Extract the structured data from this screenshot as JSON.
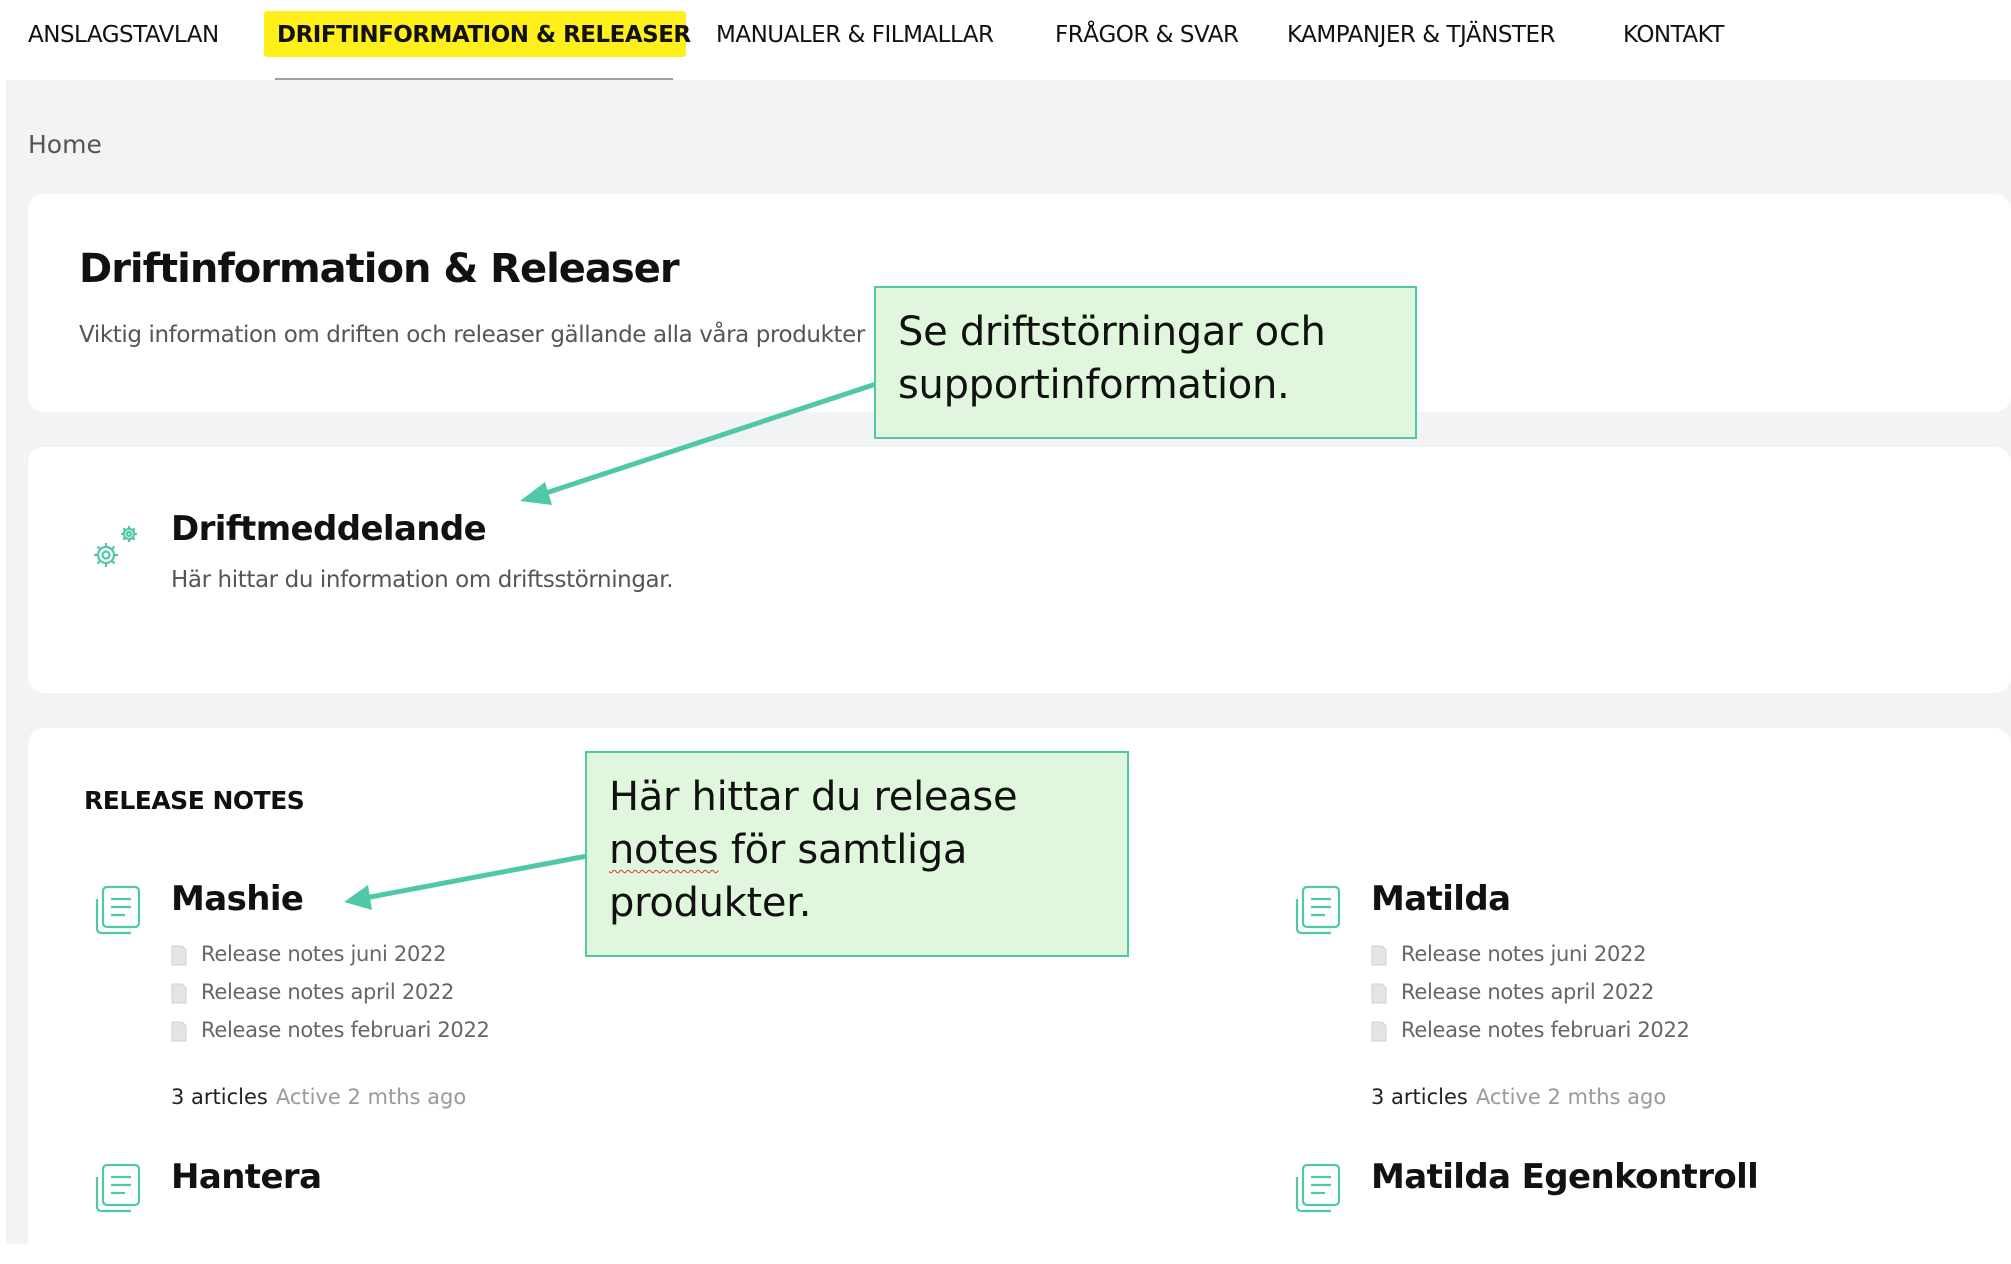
{
  "nav": {
    "items": [
      {
        "label": "ANSLAGSTAVLAN"
      },
      {
        "label": "DRIFTINFORMATION & RELEASER"
      },
      {
        "label": "MANUALER & FILMALLAR"
      },
      {
        "label": "FRÅGOR & SVAR"
      },
      {
        "label": "KAMPANJER & TJÄNSTER"
      },
      {
        "label": "KONTAKT"
      }
    ],
    "highlight_color": "#ffef1a"
  },
  "breadcrumb": "Home",
  "header": {
    "title": "Driftinformation & Releaser",
    "description": "Viktig information om driften och releaser gällande alla våra produkter"
  },
  "driftmeddelande": {
    "icon": "gears-icon",
    "title": "Driftmeddelande",
    "description": "Här hittar du information om driftsstörningar."
  },
  "release_notes": {
    "heading": "RELEASE NOTES",
    "categories": [
      {
        "icon": "document-list-icon",
        "title": "Mashie",
        "articles": [
          "Release notes juni 2022",
          "Release notes april 2022",
          "Release notes februari 2022"
        ],
        "count": "3 articles",
        "active": "Active 2 mths ago"
      },
      {
        "icon": "document-list-icon",
        "title": "Matilda",
        "articles": [
          "Release notes juni 2022",
          "Release notes april 2022",
          "Release notes februari 2022"
        ],
        "count": "3 articles",
        "active": "Active 2 mths ago"
      },
      {
        "icon": "document-list-icon",
        "title": "Hantera"
      },
      {
        "icon": "document-list-icon",
        "title": "Matilda Egenkontroll"
      }
    ]
  },
  "callouts": [
    {
      "line1": "Se driftstörningar och",
      "line2": "supportinformation."
    },
    {
      "line1": "Här hittar du release",
      "line2a": "notes",
      "line2b": " för samtliga",
      "line3": "produkter."
    }
  ],
  "colors": {
    "accent": "#50c8a8",
    "callout_bg": "#e1f7dd",
    "page_bg": "#f2f3f4"
  }
}
